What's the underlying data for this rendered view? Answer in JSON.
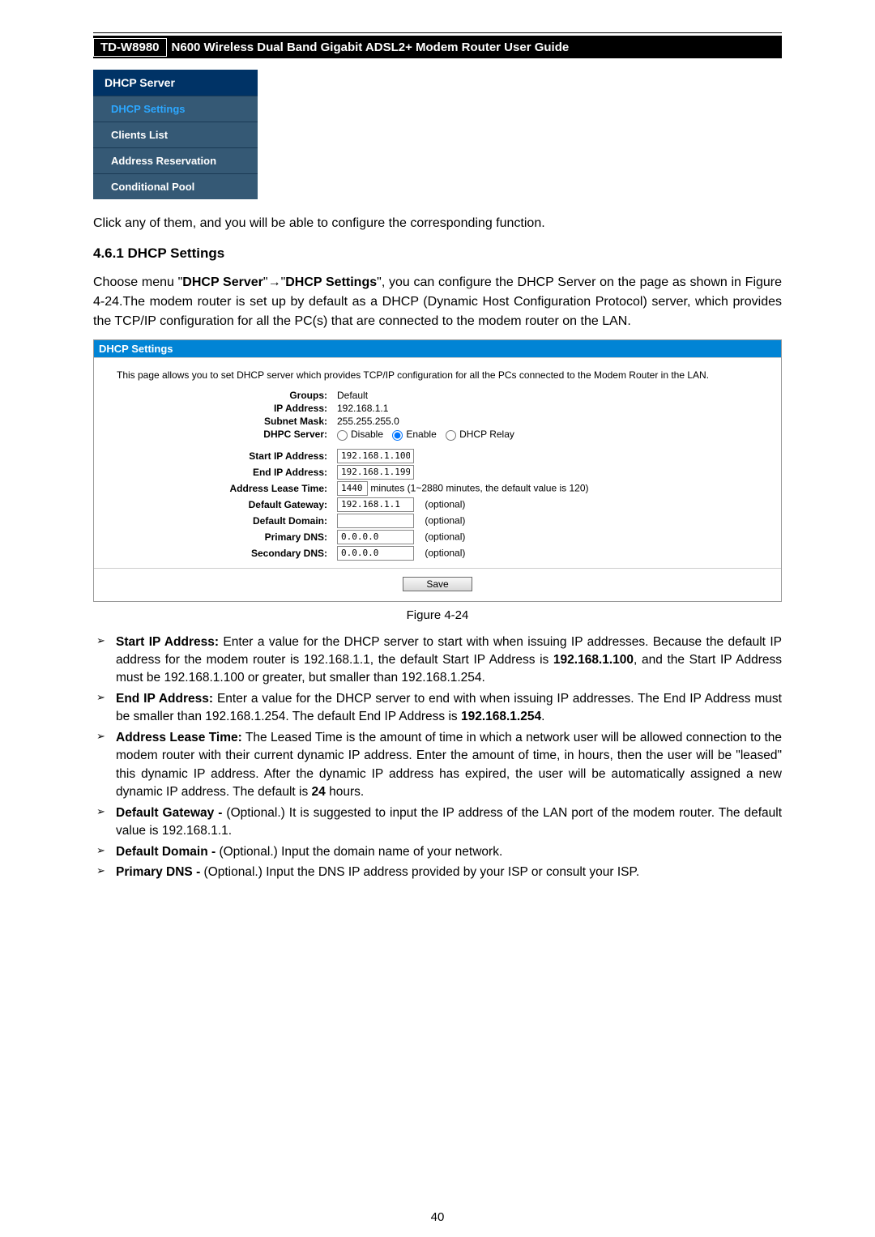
{
  "header": {
    "model": "TD-W8980",
    "title": "N600 Wireless Dual Band Gigabit ADSL2+ Modem Router User Guide"
  },
  "nav": {
    "title": "DHCP Server",
    "items": [
      {
        "label": "DHCP Settings",
        "active": true
      },
      {
        "label": "Clients List",
        "active": false
      },
      {
        "label": "Address Reservation",
        "active": false
      },
      {
        "label": "Conditional Pool",
        "active": false
      }
    ]
  },
  "intro_text": "Click any of them, and you will be able to configure the corresponding function.",
  "section_heading": "4.6.1  DHCP Settings",
  "section_para_1": "Choose menu \"",
  "section_bold_1": "DHCP Server",
  "section_arrow": "\"→\"",
  "section_bold_2": "DHCP Settings",
  "section_para_2": "\", you can configure the DHCP Server on the page as shown in Figure 4-24.The modem router is set up by default as a DHCP (Dynamic Host Configuration Protocol) server, which provides the TCP/IP configuration for all the PC(s) that are connected to the modem router on the LAN.",
  "panel": {
    "title": "DHCP Settings",
    "desc": "This page allows you to set DHCP server which provides TCP/IP configuration for all the PCs connected to the Modem Router in the LAN.",
    "groups_label": "Groups:",
    "groups_value": "Default",
    "ip_label": "IP Address:",
    "ip_value": "192.168.1.1",
    "subnet_label": "Subnet Mask:",
    "subnet_value": "255.255.255.0",
    "dhpc_label": "DHPC Server:",
    "radio_disable": "Disable",
    "radio_enable": "Enable",
    "radio_relay": "DHCP Relay",
    "start_label": "Start IP Address:",
    "start_value": "192.168.1.100",
    "end_label": "End IP Address:",
    "end_value": "192.168.1.199",
    "lease_label": "Address Lease Time:",
    "lease_value": "1440",
    "lease_suffix": " minutes (1~2880 minutes, the default value is 120)",
    "gateway_label": "Default Gateway:",
    "gateway_value": "192.168.1.1",
    "optional": "(optional)",
    "domain_label": "Default Domain:",
    "domain_value": "",
    "pdns_label": "Primary DNS:",
    "pdns_value": "0.0.0.0",
    "sdns_label": "Secondary DNS:",
    "sdns_value": "0.0.0.0",
    "save_label": "Save"
  },
  "figure_caption": "Figure 4-24",
  "bullets": {
    "b1_bold": "Start IP Address:",
    "b1_t1": " Enter a value for the DHCP server to start with when issuing IP addresses. Because the default IP address for the modem router is 192.168.1.1, the default Start IP Address is ",
    "b1_bold2": "192.168.1.100",
    "b1_t2": ", and the Start IP Address must be 192.168.1.100 or greater, but smaller than 192.168.1.254.",
    "b2_bold": "End IP Address:",
    "b2_t1": " Enter a value for the DHCP server to end with when issuing IP addresses. The End IP Address must be smaller than 192.168.1.254. The default End IP Address is ",
    "b2_bold2": "192.168.1.254",
    "b2_t2": ".",
    "b3_bold": "Address Lease Time:",
    "b3_t1": " The Leased Time is the amount of time in which a network user will be allowed connection to the modem router with their current dynamic IP address. Enter the amount of time, in hours, then the user will be \"leased\" this dynamic IP address. After the dynamic IP address has expired, the user will be automatically assigned a new dynamic IP address. The default is ",
    "b3_bold2": "24",
    "b3_t2": " hours.",
    "b4_bold": "Default Gateway -",
    "b4_t1": " (Optional.) It is suggested to input the IP address of the LAN port of the modem router. The default value is 192.168.1.1.",
    "b5_bold": "Default Domain -",
    "b5_t1": " (Optional.) Input the domain name of your network.",
    "b6_bold": "Primary DNS -",
    "b6_t1": " (Optional.) Input the DNS IP address provided by your ISP or consult your ISP."
  },
  "page_number": "40"
}
